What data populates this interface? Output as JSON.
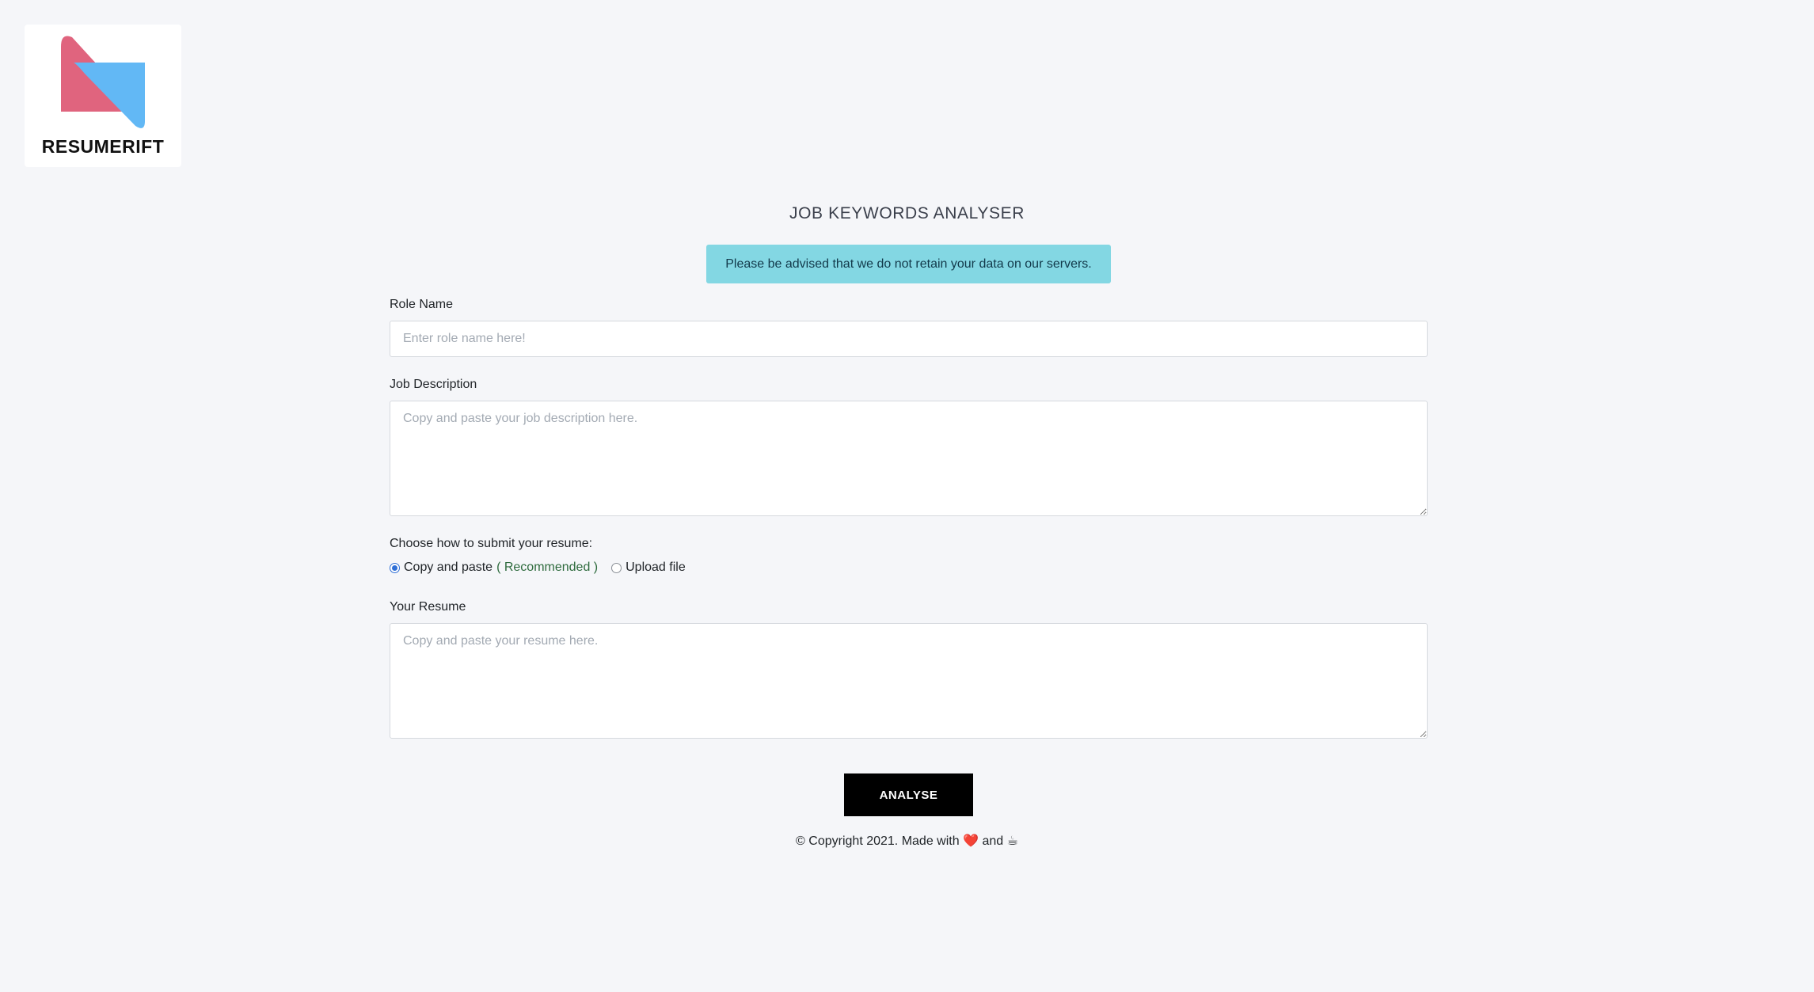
{
  "brand": {
    "name": "RESUMERIFT",
    "colors": {
      "pink": "#e0647e",
      "blue": "#62b8f5"
    }
  },
  "page": {
    "title": "JOB KEYWORDS ANALYSER",
    "notice": "Please be advised that we do not retain your data on our servers."
  },
  "form": {
    "role_name": {
      "label": "Role Name",
      "placeholder": "Enter role name here!",
      "value": ""
    },
    "job_description": {
      "label": "Job Description",
      "placeholder": "Copy and paste your job description here.",
      "value": ""
    },
    "submit_method": {
      "label": "Choose how to submit your resume:",
      "options": [
        {
          "label": "Copy and paste",
          "note": "( Recommended )",
          "selected": true
        },
        {
          "label": "Upload file",
          "selected": false
        }
      ]
    },
    "resume": {
      "label": "Your Resume",
      "placeholder": "Copy and paste your resume here.",
      "value": ""
    },
    "submit_label": "ANALYSE"
  },
  "footer": {
    "prefix": "© Copyright 2021. Made with",
    "heart": "❤️",
    "and": "and",
    "coffee": "☕"
  }
}
